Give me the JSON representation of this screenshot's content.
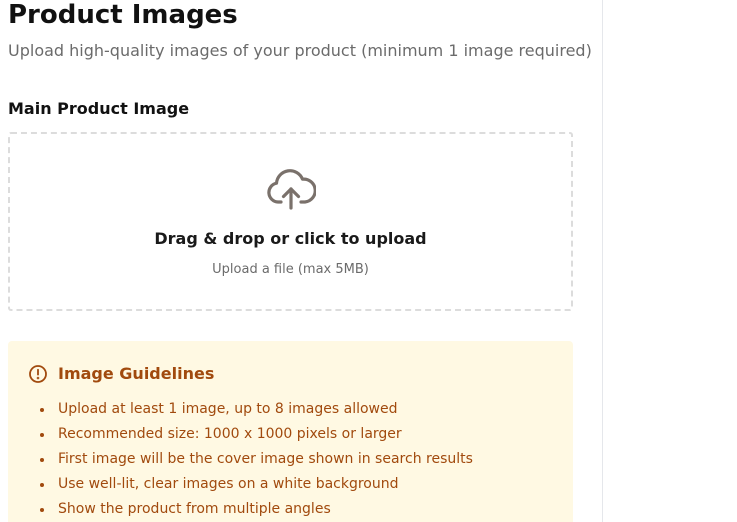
{
  "header": {
    "title": "Product Images",
    "subtitle": "Upload high-quality images of your product (minimum 1 image required)"
  },
  "main_image": {
    "label": "Main Product Image",
    "dropzone": {
      "icon": "cloud-upload-icon",
      "title": "Drag & drop or click to upload",
      "hint": "Upload a file (max 5MB)"
    }
  },
  "guidelines": {
    "icon": "alert-circle-icon",
    "title": "Image Guidelines",
    "items": [
      "Upload at least 1 image, up to 8 images allowed",
      "Recommended size: 1000 x 1000 pixels or larger",
      "First image will be the cover image shown in search results",
      "Use well-lit, clear images on a white background",
      "Show the product from multiple angles"
    ]
  },
  "colors": {
    "text_primary": "#111111",
    "text_muted": "#6b6b6b",
    "icon_gray": "#7a716b",
    "dropzone_border": "#dcdcdc",
    "guideline_bg": "#fff9e3",
    "guideline_text": "#a14a0e"
  }
}
